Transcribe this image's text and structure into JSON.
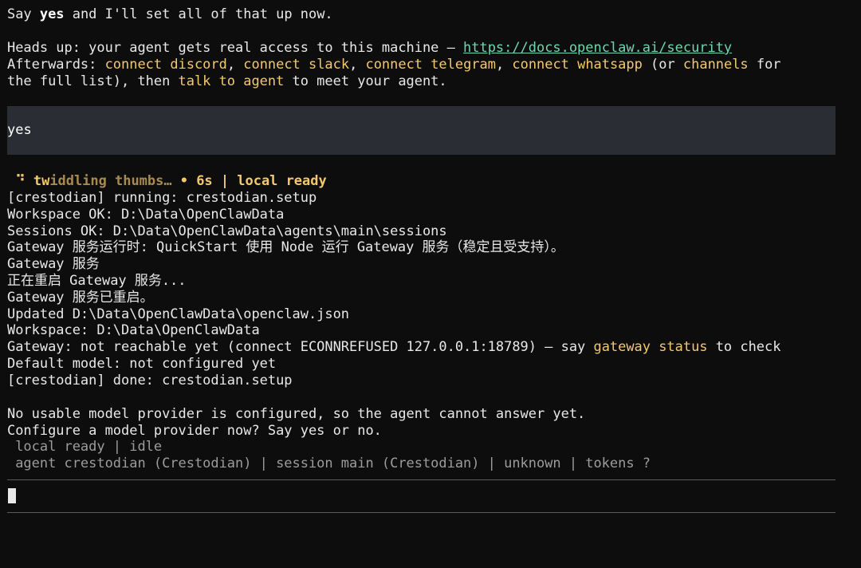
{
  "intro": {
    "line1": {
      "a": "Say ",
      "b": "yes",
      "c": " and I'll set all of that up now."
    },
    "line2": {
      "a": "Heads up: your agent gets real access to this machine — ",
      "url": "https://docs.openclaw.ai/security"
    },
    "line3": {
      "a": "Afterwards: ",
      "k1": "connect discord",
      "s1": ", ",
      "k2": "connect slack",
      "s2": ", ",
      "k3": "connect telegram",
      "s3": ", ",
      "k4": "connect whatsapp",
      "s4": " (or ",
      "k5": "channels",
      "s5": " for"
    },
    "line4": {
      "a": "the full list), then ",
      "k": "talk to agent",
      "b": " to meet your agent."
    }
  },
  "user_input": "yes",
  "status_line": {
    "spinner": "⠙",
    "label_bright": "tw",
    "label_dim": "iddling thumbs…",
    "sep": " • ",
    "elapsed": "6s",
    "pipe": " | ",
    "state": "local ready"
  },
  "log_lines": [
    "[crestodian] running: crestodian.setup",
    "Workspace OK: D:\\Data\\OpenClawData",
    "Sessions OK: D:\\Data\\OpenClawData\\agents\\main\\sessions",
    "Gateway 服务运行时: QuickStart 使用 Node 运行 Gateway 服务（稳定且受支持）。",
    "Gateway 服务",
    "正在重启 Gateway 服务...",
    "Gateway 服务已重启。",
    "Updated D:\\Data\\OpenClawData\\openclaw.json",
    "Workspace: D:\\Data\\OpenClawData"
  ],
  "gateway_line": {
    "a": "Gateway: not reachable yet (connect ECONNREFUSED 127.0.0.1:18789) — say ",
    "k": "gateway status",
    "b": " to check"
  },
  "log_lines_after": [
    "Default model: not configured yet",
    "[crestodian] done: crestodian.setup"
  ],
  "prompt_lines": [
    "No usable model provider is configured, so the agent cannot answer yet.",
    "Configure a model provider now? Say yes or no."
  ],
  "footer": {
    "status": " local ready | idle",
    "session": " agent crestodian (Crestodian) | session main (Crestodian) | unknown | tokens ?"
  },
  "colors": {
    "background": "#0d0d0d",
    "keyword": "#f2c96d",
    "link": "#6fd6b0",
    "input_bg": "#2a2d33"
  }
}
